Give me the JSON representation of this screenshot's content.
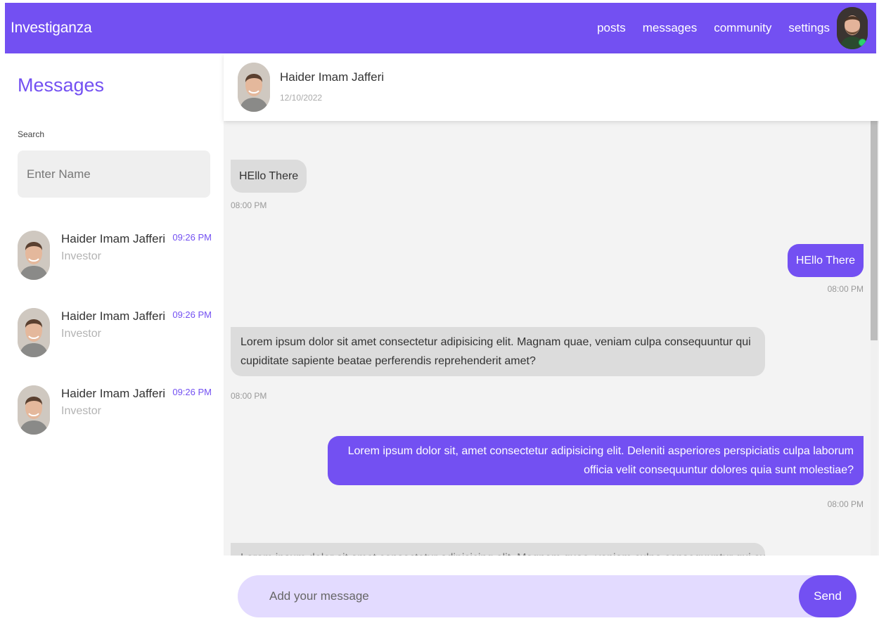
{
  "app": {
    "brand": "Investiganza"
  },
  "nav": {
    "items": [
      "posts",
      "messages",
      "community",
      "settings"
    ]
  },
  "sidebar": {
    "title": "Messages",
    "search_label": "Search",
    "search_placeholder": "Enter Name",
    "contacts": [
      {
        "name": "Haider Imam Jafferi",
        "role": "Investor",
        "time": "09:26 PM"
      },
      {
        "name": "Haider Imam Jafferi",
        "role": "Investor",
        "time": "09:26 PM"
      },
      {
        "name": "Haider Imam Jafferi",
        "role": "Investor",
        "time": "09:26 PM"
      }
    ]
  },
  "chat": {
    "header": {
      "name": "Haider Imam Jafferi",
      "date": "12/10/2022"
    },
    "messages": [
      {
        "direction": "in",
        "text": "HEllo There",
        "time": "08:00 PM"
      },
      {
        "direction": "out",
        "text": "HEllo There",
        "time": "08:00 PM"
      },
      {
        "direction": "in",
        "text": "Lorem ipsum dolor sit amet consectetur adipisicing elit. Magnam quae, veniam culpa consequuntur qui cupiditate sapiente beatae perferendis reprehenderit amet?",
        "time": "08:00 PM"
      },
      {
        "direction": "out",
        "text": "Lorem ipsum dolor sit, amet consectetur adipisicing elit. Deleniti asperiores perspiciatis culpa laborum officia velit consequuntur dolores quia sunt molestiae?",
        "time": "08:00 PM"
      },
      {
        "direction": "in",
        "text": "Lorem ipsum dolor sit amet consectetur adipisicing elit. Magnam quae, veniam culpa consequuntur qui cupiditate",
        "time": ""
      }
    ],
    "composer": {
      "placeholder": "Add your message",
      "send_label": "Send"
    }
  },
  "colors": {
    "accent": "#7350f2",
    "incoming_bubble": "#dcdcdc",
    "composer_bg": "#e3dbff",
    "online": "#2bd36d"
  }
}
